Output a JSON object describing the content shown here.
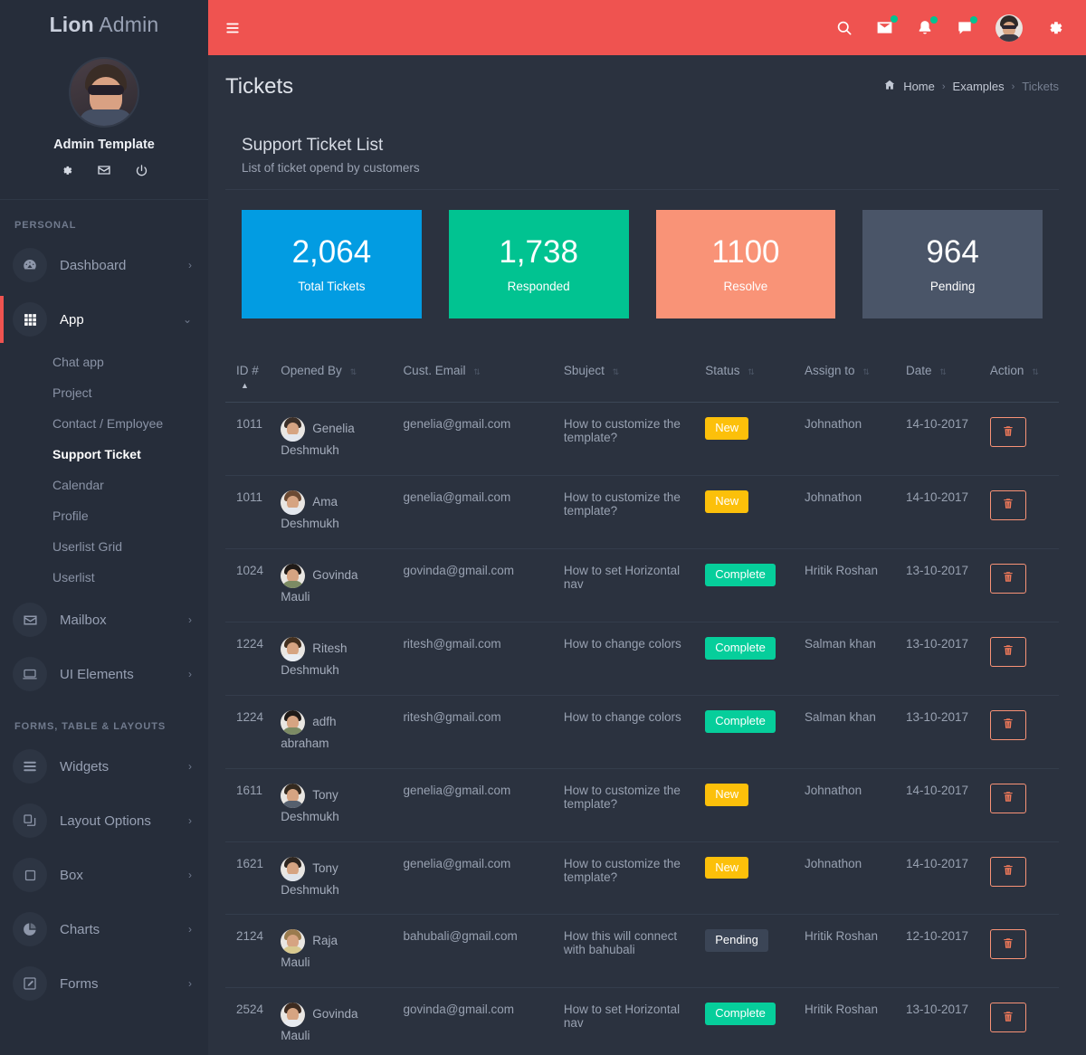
{
  "brand": {
    "bold": "Lion",
    "light": "Admin"
  },
  "profile": {
    "name": "Admin Template",
    "icons": [
      "gear-icon",
      "envelope-icon",
      "power-icon"
    ]
  },
  "sidebar": {
    "section_personal": "PERSONAL",
    "section_forms": "FORMS, TABLE & LAYOUTS",
    "items": [
      {
        "label": "Dashboard",
        "icon": "dashboard-icon",
        "arrow": "›",
        "active": false
      },
      {
        "label": "App",
        "icon": "grid-icon",
        "arrow": "⌄",
        "active": true
      },
      {
        "label": "Mailbox",
        "icon": "envelope-icon",
        "arrow": "›",
        "active": false
      },
      {
        "label": "UI Elements",
        "icon": "monitor-icon",
        "arrow": "›",
        "active": false
      },
      {
        "label": "Widgets",
        "icon": "list-icon",
        "arrow": "›",
        "active": false
      },
      {
        "label": "Layout Options",
        "icon": "layers-icon",
        "arrow": "›",
        "active": false
      },
      {
        "label": "Box",
        "icon": "square-icon",
        "arrow": "›",
        "active": false
      },
      {
        "label": "Charts",
        "icon": "pie-chart-icon",
        "arrow": "›",
        "active": false
      },
      {
        "label": "Forms",
        "icon": "edit-icon",
        "arrow": "›",
        "active": false
      }
    ],
    "app_submenu": [
      {
        "label": "Chat app",
        "active": false
      },
      {
        "label": "Project",
        "active": false
      },
      {
        "label": "Contact / Employee",
        "active": false
      },
      {
        "label": "Support Ticket",
        "active": true
      },
      {
        "label": "Calendar",
        "active": false
      },
      {
        "label": "Profile",
        "active": false
      },
      {
        "label": "Userlist Grid",
        "active": false
      },
      {
        "label": "Userlist",
        "active": false
      }
    ]
  },
  "topbar": {
    "menu_icon": "hamburger-icon",
    "actions": [
      {
        "icon": "search-icon",
        "badge": false
      },
      {
        "icon": "envelope-icon",
        "badge": true
      },
      {
        "icon": "bell-icon",
        "badge": true
      },
      {
        "icon": "chat-icon",
        "badge": true
      }
    ],
    "settings_icon": "gear-icon",
    "accent": "#ef5350",
    "badge_color": "#01c391"
  },
  "page": {
    "title": "Tickets",
    "breadcrumb": [
      {
        "label": "Home",
        "muted": false
      },
      {
        "label": "Examples",
        "muted": false
      },
      {
        "label": "Tickets",
        "muted": true
      }
    ],
    "breadcrumb_icon": "home-icon",
    "separator": "›"
  },
  "card": {
    "title": "Support Ticket List",
    "subtitle": "List of ticket opend by customers"
  },
  "stats": [
    {
      "value": "2,064",
      "label": "Total Tickets",
      "color": "#029ce2"
    },
    {
      "value": "1,738",
      "label": "Responded",
      "color": "#01c391"
    },
    {
      "value": "1100",
      "label": "Resolve",
      "color": "#f99377"
    },
    {
      "value": "964",
      "label": "Pending",
      "color": "#4a5568"
    }
  ],
  "table": {
    "columns": [
      {
        "label": "ID #",
        "sort": "asc"
      },
      {
        "label": "Opened By",
        "sort": "none"
      },
      {
        "label": "Cust. Email",
        "sort": "none"
      },
      {
        "label": "Sbuject",
        "sort": "none"
      },
      {
        "label": "Status",
        "sort": "none"
      },
      {
        "label": "Assign to",
        "sort": "none"
      },
      {
        "label": "Date",
        "sort": "none"
      },
      {
        "label": "Action",
        "sort": "none"
      }
    ],
    "action_icon": "trash-icon",
    "rows": [
      {
        "id": "1011",
        "user": "Genelia Deshmukh",
        "email": "genelia@gmail.com",
        "subject": "How to customize the template?",
        "status": "New",
        "status_type": "new",
        "assign": "Johnathon",
        "date": "14-10-2017",
        "hair": "#3b2f28",
        "body": "#e3e7ee"
      },
      {
        "id": "1011",
        "user": "Ama Deshmukh",
        "email": "genelia@gmail.com",
        "subject": "How to customize the template?",
        "status": "New",
        "status_type": "new",
        "assign": "Johnathon",
        "date": "14-10-2017",
        "hair": "#6b4a33",
        "body": "#e3e7ee"
      },
      {
        "id": "1024",
        "user": "Govinda Mauli",
        "email": "govinda@gmail.com",
        "subject": "How to set Horizontal nav",
        "status": "Complete",
        "status_type": "complete",
        "assign": "Hritik Roshan",
        "date": "13-10-2017",
        "hair": "#1f1a17",
        "body": "#7c8b64"
      },
      {
        "id": "1224",
        "user": "Ritesh Deshmukh",
        "email": "ritesh@gmail.com",
        "subject": "How to change colors",
        "status": "Complete",
        "status_type": "complete",
        "assign": "Salman khan",
        "date": "13-10-2017",
        "hair": "#43301f",
        "body": "#e9edf3"
      },
      {
        "id": "1224",
        "user": "adfh abraham",
        "email": "ritesh@gmail.com",
        "subject": "How to change colors",
        "status": "Complete",
        "status_type": "complete",
        "assign": "Salman khan",
        "date": "13-10-2017",
        "hair": "#1f1a17",
        "body": "#7c8b64"
      },
      {
        "id": "1611",
        "user": "Tony Deshmukh",
        "email": "genelia@gmail.com",
        "subject": "How to customize the template?",
        "status": "New",
        "status_type": "new",
        "assign": "Johnathon",
        "date": "14-10-2017",
        "hair": "#33291f",
        "body": "#56606e"
      },
      {
        "id": "1621",
        "user": "Tony Deshmukh",
        "email": "genelia@gmail.com",
        "subject": "How to customize the template?",
        "status": "New",
        "status_type": "new",
        "assign": "Johnathon",
        "date": "14-10-2017",
        "hair": "#2e2620",
        "body": "#dfe4eb"
      },
      {
        "id": "2124",
        "user": "Raja Mauli",
        "email": "bahubali@gmail.com",
        "subject": "How this will connect with bahubali",
        "status": "Pending",
        "status_type": "pending",
        "assign": "Hritik Roshan",
        "date": "12-10-2017",
        "hair": "#9a7b4e",
        "body": "#d8c98f"
      },
      {
        "id": "2524",
        "user": "Govinda Mauli",
        "email": "govinda@gmail.com",
        "subject": "How to set Horizontal nav",
        "status": "Complete",
        "status_type": "complete",
        "assign": "Hritik Roshan",
        "date": "13-10-2017",
        "hair": "#3d2b20",
        "body": "#e8ebf0"
      }
    ]
  }
}
